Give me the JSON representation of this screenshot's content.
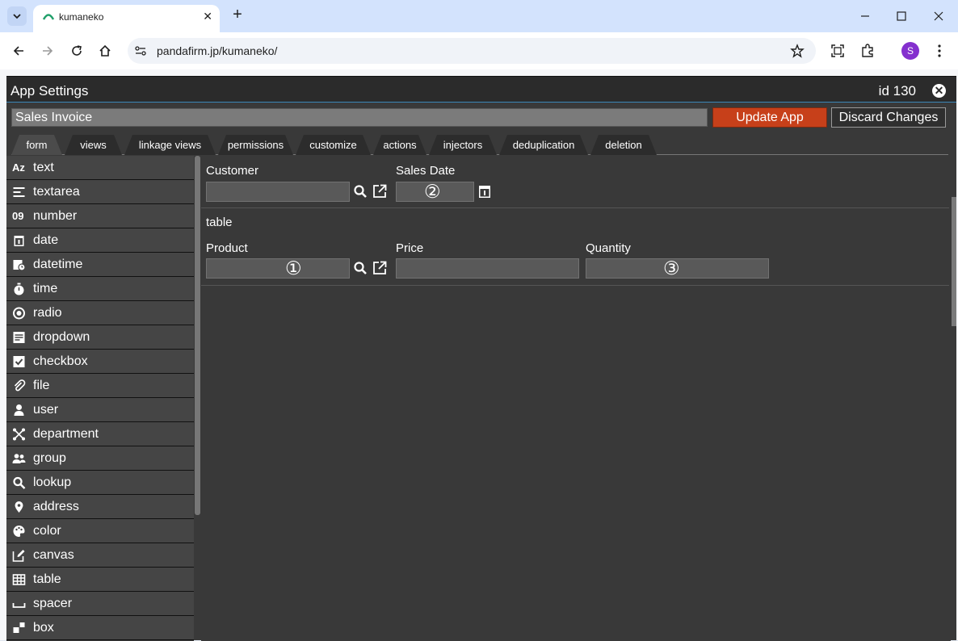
{
  "browser": {
    "tab_title": "kumaneko",
    "new_tab": "+",
    "url": "pandafirm.jp/kumaneko/",
    "profile_initial": "S"
  },
  "dialog": {
    "title": "App Settings",
    "app_id": "id 130",
    "app_name": "Sales Invoice",
    "update_label": "Update App",
    "discard_label": "Discard Changes",
    "accent_color": "#c7401a"
  },
  "tabs": [
    {
      "label": "form",
      "active": true
    },
    {
      "label": "views"
    },
    {
      "label": "linkage views"
    },
    {
      "label": "permissions"
    },
    {
      "label": "customize"
    },
    {
      "label": "actions"
    },
    {
      "label": "injectors"
    },
    {
      "label": "deduplication"
    },
    {
      "label": "deletion"
    }
  ],
  "palette": [
    {
      "label": "text",
      "icon": "Az"
    },
    {
      "label": "textarea",
      "icon": "textarea-icon"
    },
    {
      "label": "number",
      "icon": "09"
    },
    {
      "label": "date",
      "icon": "calendar-icon"
    },
    {
      "label": "datetime",
      "icon": "datetime-icon"
    },
    {
      "label": "time",
      "icon": "stopwatch-icon"
    },
    {
      "label": "radio",
      "icon": "radio-icon"
    },
    {
      "label": "dropdown",
      "icon": "dropdown-icon"
    },
    {
      "label": "checkbox",
      "icon": "checkbox-icon"
    },
    {
      "label": "file",
      "icon": "paperclip-icon"
    },
    {
      "label": "user",
      "icon": "user-icon"
    },
    {
      "label": "department",
      "icon": "department-icon"
    },
    {
      "label": "group",
      "icon": "group-icon"
    },
    {
      "label": "lookup",
      "icon": "search-icon"
    },
    {
      "label": "address",
      "icon": "map-pin-icon"
    },
    {
      "label": "color",
      "icon": "palette-icon"
    },
    {
      "label": "canvas",
      "icon": "edit-icon"
    },
    {
      "label": "table",
      "icon": "table-icon"
    },
    {
      "label": "spacer",
      "icon": "spacer-icon"
    },
    {
      "label": "box",
      "icon": "box-icon"
    }
  ],
  "form": {
    "customer_label": "Customer",
    "sales_date_label": "Sales Date",
    "sales_date_marker": "②",
    "table_label": "table",
    "product_label": "Product",
    "product_marker": "①",
    "price_label": "Price",
    "quantity_label": "Quantity",
    "quantity_marker": "③"
  }
}
